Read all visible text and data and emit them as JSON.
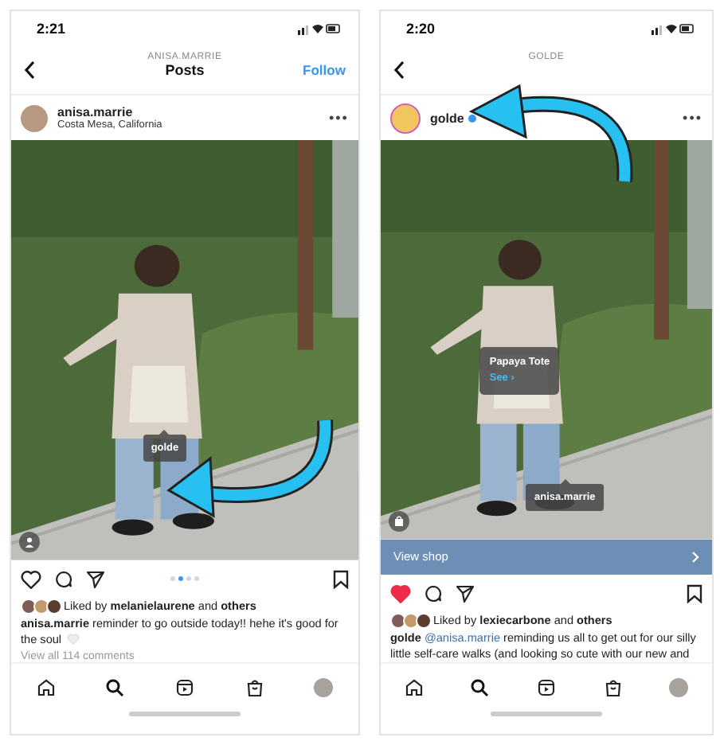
{
  "screens": [
    {
      "time": "2:21",
      "header": {
        "subtitle": "ANISA.MARRIE",
        "title": "Posts",
        "action": "Follow"
      },
      "post": {
        "username": "anisa.marrie",
        "location": "Costa Mesa, California",
        "verified": false,
        "more": "•••"
      },
      "tags": [
        {
          "kind": "account",
          "text": "golde"
        }
      ],
      "photo_badge": {
        "kind": "person"
      },
      "dots": [
        {
          "selected": false
        },
        {
          "selected": true
        },
        {
          "selected": false
        },
        {
          "selected": false
        }
      ],
      "liked": false,
      "likes": "Liked by **melanielaurene** and **others**",
      "caption": {
        "author": "anisa.marrie",
        "text": "reminder to go outside today!! hehe it's good for the soul"
      },
      "caption_heart": true,
      "comments": "View all 114 comments"
    },
    {
      "time": "2:20",
      "header": {
        "subtitle": "GOLDE"
      },
      "post": {
        "username": "golde",
        "verified": true,
        "avatar": {
          "kind": "ring"
        },
        "more": "•••"
      },
      "tags": [
        {
          "kind": "product",
          "text": "Papaya Tote",
          "link": "See ›"
        },
        {
          "kind": "account",
          "text": "anisa.marrie"
        }
      ],
      "photo_badge": {
        "kind": "bag"
      },
      "view_shop": "View shop",
      "liked": true,
      "likes": "Liked by **lexiecarbone** and **others**",
      "caption": {
        "author": "golde",
        "mention": "@anisa.marrie",
        "text": "reminding us all to get out for our silly little self-care walks (and looking so cute with our new and"
      },
      "caption_heart": false
    }
  ]
}
